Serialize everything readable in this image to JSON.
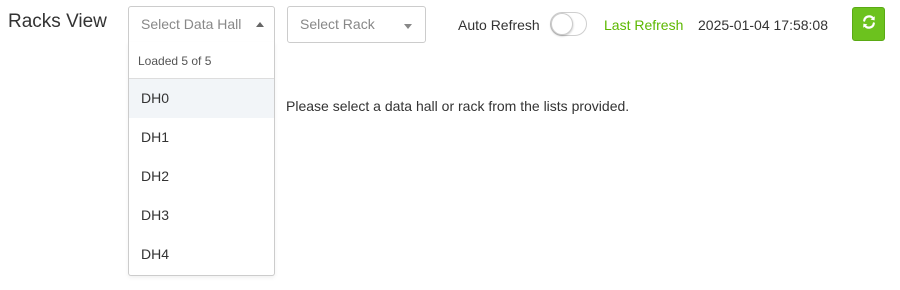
{
  "header": {
    "title": "Racks View"
  },
  "filters": {
    "data_hall_select": {
      "placeholder": "Select Data Hall",
      "open": true,
      "dropdown": {
        "status": "Loaded 5 of 5",
        "options": [
          "DH0",
          "DH1",
          "DH2",
          "DH3",
          "DH4"
        ],
        "highlighted_index": 0
      }
    },
    "rack_select": {
      "placeholder": "Select Rack"
    }
  },
  "auto_refresh": {
    "label": "Auto Refresh",
    "enabled": false
  },
  "last_refresh": {
    "label": "Last Refresh",
    "timestamp": "2025-01-04 17:58:08"
  },
  "refresh_button": {
    "icon": "refresh-icon"
  },
  "main": {
    "message": "Please select a data hall or rack from the lists provided."
  },
  "colors": {
    "accent_green": "#6cc21e",
    "last_refresh_text": "#5cb800",
    "highlight_row": "#f2f5f8"
  }
}
